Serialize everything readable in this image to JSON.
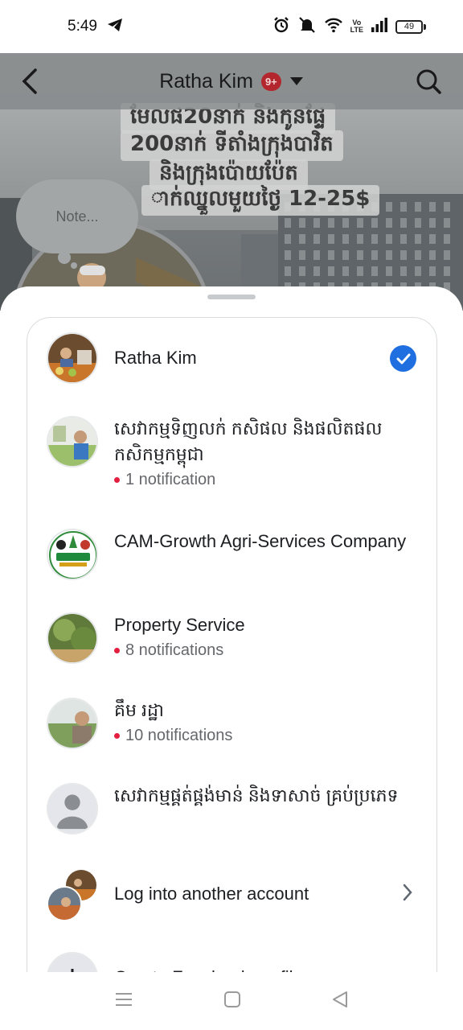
{
  "status_bar": {
    "time": "5:49",
    "battery": "49",
    "volte_top": "Vo",
    "volte_bottom": "LTE"
  },
  "profile": {
    "name": "Ratha Kim",
    "badge": "9+",
    "note_placeholder": "Note...",
    "cover_text": [
      "មែលផ20នាក់ និងកូនផ្ទែ",
      "200នាក់ ទីតាំងក្រុងបាវិត",
      "និងក្រុងប៉ោយប៉ែត",
      "ាក់ឈ្នួលមួយថ្ងៃ 12-25$"
    ]
  },
  "accounts": [
    {
      "name": "Ratha Kim",
      "selected": true,
      "notifications": ""
    },
    {
      "name": "សេវាកម្មទិញលក់ កសិផល និងផលិតផលកសិកម្មកម្ពុជា",
      "selected": false,
      "notifications": "1 notification"
    },
    {
      "name": "CAM-Growth Agri-Services Company",
      "selected": false,
      "notifications": ""
    },
    {
      "name": "Property Service",
      "selected": false,
      "notifications": "8 notifications"
    },
    {
      "name": "គឹម រដ្ឋា",
      "selected": false,
      "notifications": "10 notifications"
    },
    {
      "name": "សេវាកម្មផ្គត់ផ្គង់មាន់ និងទាសាច់ គ្រប់ប្រភេទ",
      "selected": false,
      "notifications": ""
    }
  ],
  "actions": {
    "login_other": "Log into another account",
    "create_profile": "Create Facebook profile"
  },
  "colors": {
    "accent": "#1f6fe0",
    "notif_dot": "#e41e3f",
    "badge": "#b3262d"
  }
}
